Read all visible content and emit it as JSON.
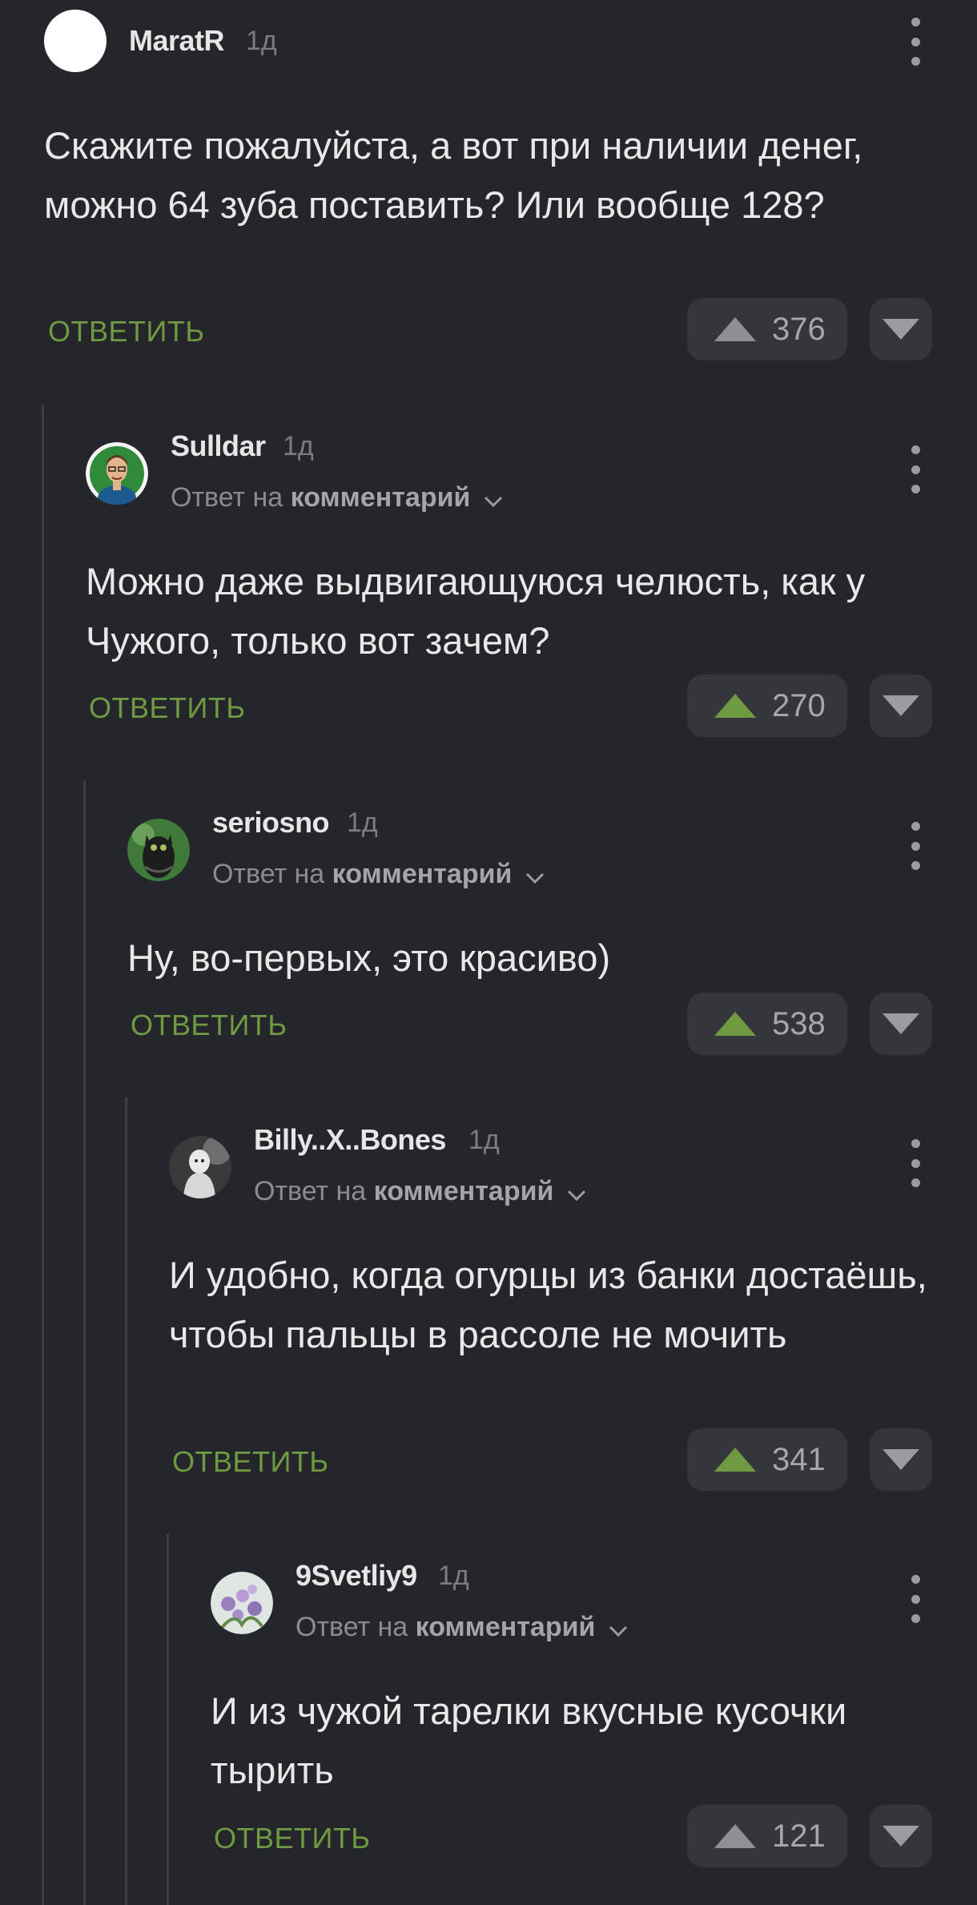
{
  "labels": {
    "reply_prefix": "Ответ на",
    "reply_link": "комментарий",
    "reply_button": "ОТВЕТИТЬ"
  },
  "colors": {
    "background": "#24262b",
    "accent_green": "#6f9a42",
    "upvote_active": "#6f9a42",
    "upvote_inactive": "#8e9095"
  },
  "comments": [
    {
      "username": "MaratR",
      "time": "1д",
      "text": "Скажите пожалуйста, а вот при наличии денег, можно 64 зуба поставить? Или вообще 128?",
      "rating": "376",
      "upvoted": false,
      "avatar": "blank-avatar"
    },
    {
      "username": "Sulldar",
      "time": "1д",
      "text": "Можно даже выдвигающуюся челюсть, как у Чужого, только вот зачем?",
      "rating": "270",
      "upvoted": true,
      "avatar": "cartoon-man-avatar"
    },
    {
      "username": "seriosno",
      "time": "1д",
      "text": "Ну, во-первых, это красиво)",
      "rating": "538",
      "upvoted": true,
      "avatar": "dark-creature-avatar"
    },
    {
      "username": "Billy..X..Bones",
      "time": "1д",
      "text": "И удобно, когда огурцы из банки достаёшь, чтобы пальцы в рассоле не мочить",
      "rating": "341",
      "upvoted": true,
      "avatar": "bw-figure-avatar"
    },
    {
      "username": "9Svetliy9",
      "time": "1д",
      "text": "И из чужой тарелки вкусные кусочки тырить",
      "rating": "121",
      "upvoted": false,
      "avatar": "flowers-avatar"
    }
  ]
}
